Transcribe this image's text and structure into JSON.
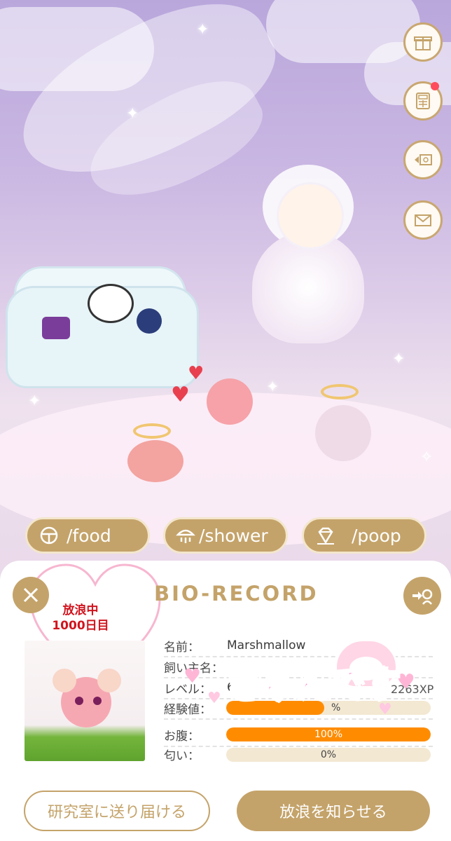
{
  "colors": {
    "accent_gold": "#c4a36a",
    "notification": "#ff4b5c",
    "bar_fill": "#ff8c00",
    "stray_text": "#d0141e"
  },
  "side_buttons": [
    {
      "icon": "gift-icon"
    },
    {
      "icon": "calculator-icon",
      "badge": true
    },
    {
      "icon": "ticket-exchange-icon"
    },
    {
      "icon": "mail-icon"
    }
  ],
  "actions": [
    {
      "label": "/food",
      "icon": "food-bowl-icon"
    },
    {
      "label": "/shower",
      "icon": "shower-icon"
    },
    {
      "label": "/poop",
      "icon": "diamond-icon"
    }
  ],
  "panel": {
    "title": "BIO-RECORD",
    "status_line1": "放浪中",
    "status_line2": "1000日目",
    "rows": {
      "name_label": "名前：",
      "name_value": "Marshmallow",
      "owner_label": "飼い主名：",
      "owner_value": "",
      "level_label": "レベル：",
      "level_value": "6",
      "xp_value": "2263XP",
      "exp_label": "経験値：",
      "exp_percent_text": "%",
      "hunger_label": "お腹：",
      "hunger_text": "100%",
      "hunger_fill": 1.0,
      "smell_label": "匂い：",
      "smell_text": "0%",
      "smell_fill": 0.0
    },
    "sticker": "きゅんです",
    "button_send": "研究室に送り届ける",
    "button_notify": "放浪を知らせる"
  }
}
